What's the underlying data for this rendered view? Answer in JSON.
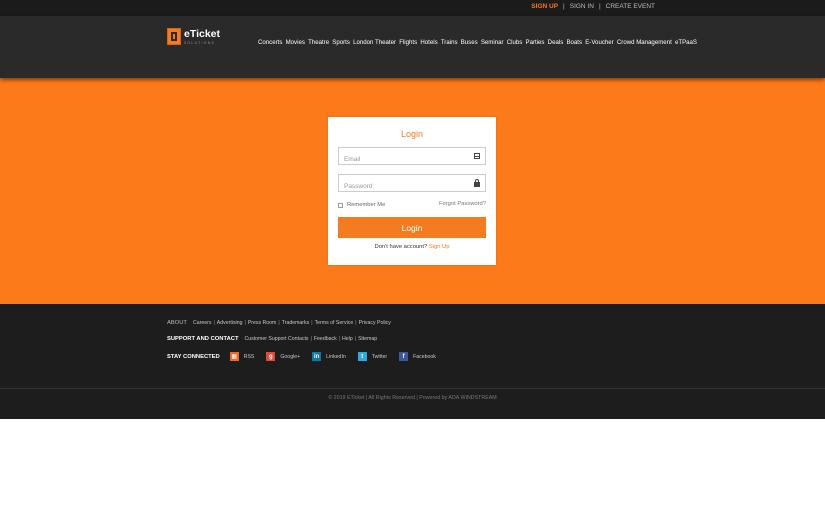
{
  "topbar": {
    "signup": "SIGN UP",
    "signin": "SIGN IN",
    "create_event": "CREATE EVENT",
    "separator": "|"
  },
  "brand": {
    "name": "eTicket",
    "tagline": "SOLUTIONS",
    "accent_color": "#f47b20",
    "hero_color": "#fd7a1b"
  },
  "nav": {
    "items": [
      "Concerts",
      "Movies",
      "Theatre",
      "Sports",
      "London Theater",
      "Flights",
      "Hotels",
      "Trains",
      "Buses",
      "Seminar",
      "Clubs",
      "Parties",
      "Deals",
      "Boats",
      "E-Voucher",
      "Crowd Management",
      "eTPaaS"
    ]
  },
  "login": {
    "title": "Login",
    "email_placeholder": "Email",
    "email_icon": "envelope-icon",
    "password_placeholder": "Password",
    "password_icon": "lock-icon",
    "remember_label": "Remember Me",
    "forgot_label": "Forgot Password?",
    "button_label": "Login",
    "no_account_text": "Don't have account?",
    "signup_link": "Sign Up"
  },
  "footer": {
    "about_label": "ABOUT",
    "about_links": [
      "Careers",
      "Advertising",
      "Press Room",
      "Trademarks",
      "Terms of Service",
      "Privacy Policy"
    ],
    "support_label": "SUPPORT AND CONTACT",
    "support_links": [
      "Customer Support Contacts",
      "Feedback",
      "Help",
      "Sitemap"
    ],
    "stay_label": "STAY CONNECTED",
    "social": [
      {
        "name": "RSS",
        "icon": "rss-icon",
        "color": "#f26522",
        "glyph": "▦"
      },
      {
        "name": "Google+",
        "icon": "google-plus-icon",
        "color": "#dd4b39",
        "glyph": "g"
      },
      {
        "name": "LinkedIn",
        "icon": "linkedin-icon",
        "color": "#0e76a8",
        "glyph": "in"
      },
      {
        "name": "Twitter",
        "icon": "twitter-icon",
        "color": "#2fa9e1",
        "glyph": "t"
      },
      {
        "name": "Facebook",
        "icon": "facebook-icon",
        "color": "#3b5998",
        "glyph": "f"
      }
    ],
    "copyright": "© 2019 ETicket | All Rights Reserved | Powered by ADA WINDSTREAM"
  }
}
